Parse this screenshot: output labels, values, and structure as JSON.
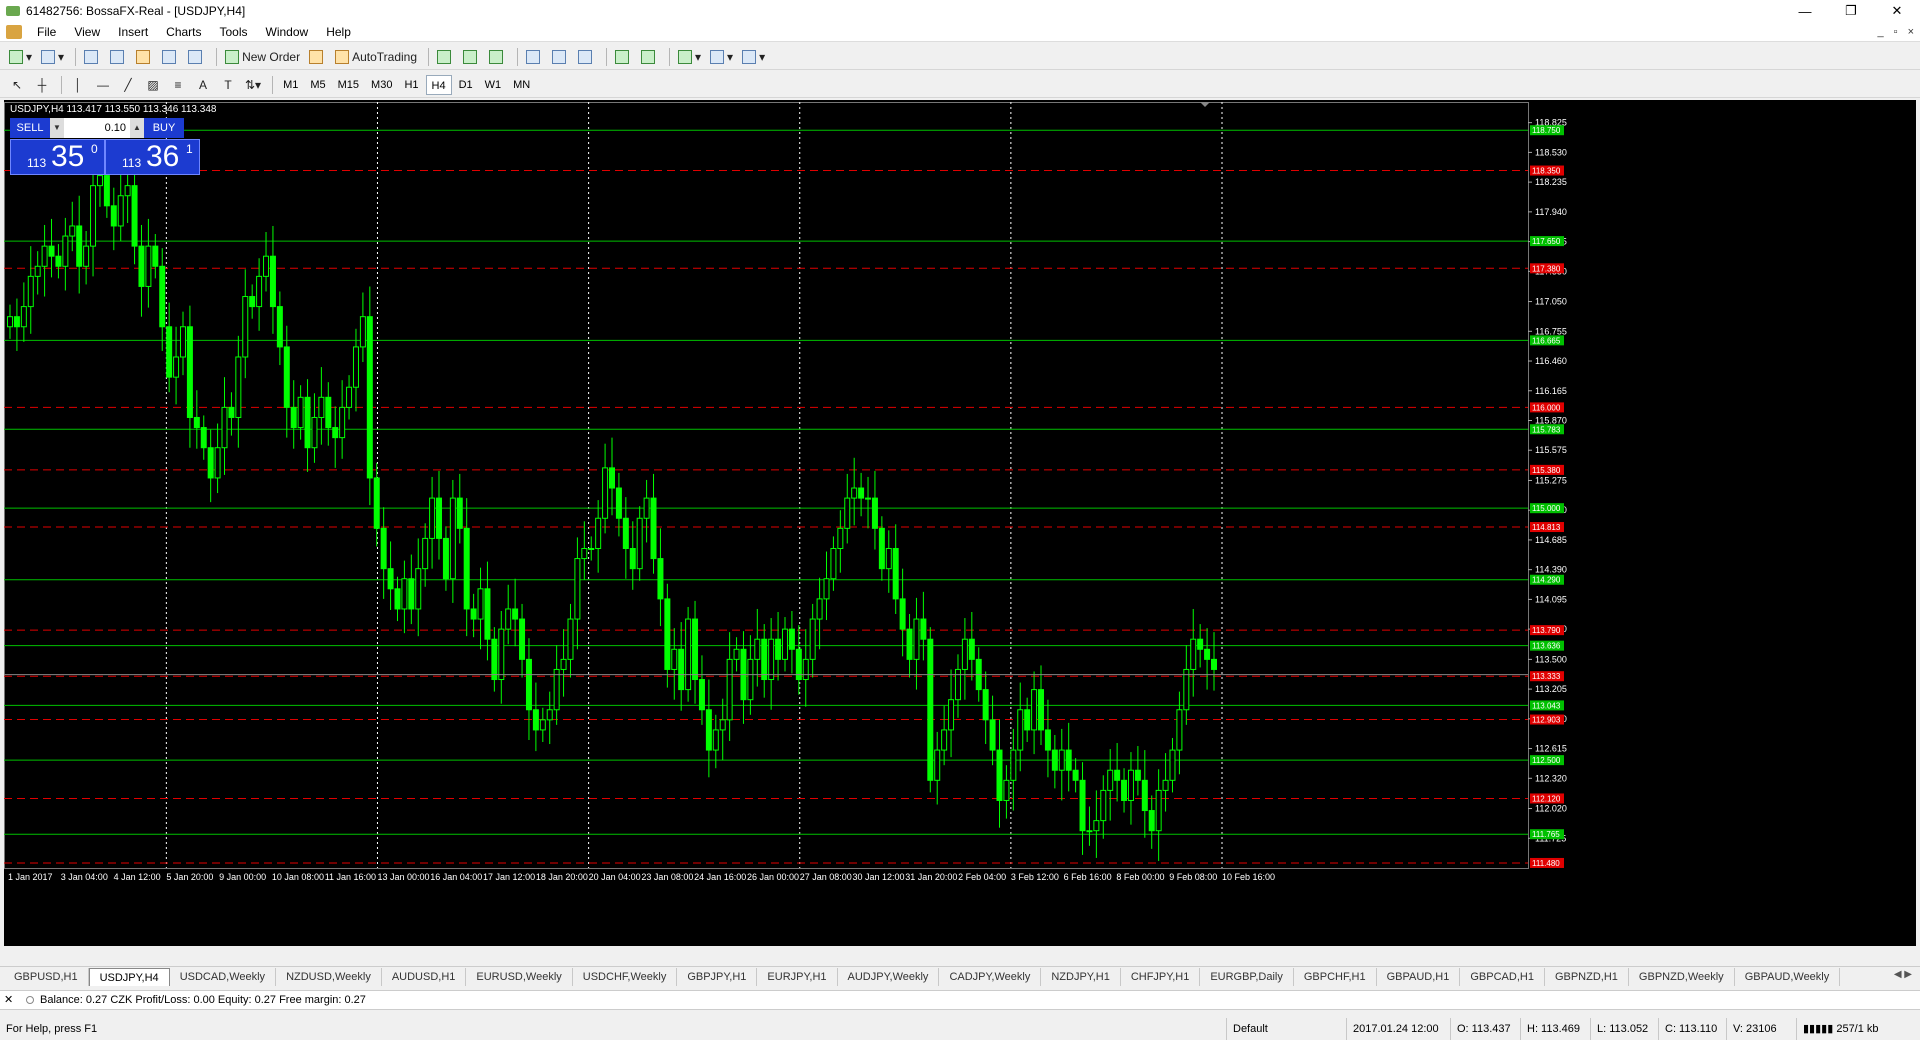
{
  "window": {
    "title": "61482756: BossaFX-Real - [USDJPY,H4]",
    "controls": [
      "—",
      "❐",
      "✕"
    ]
  },
  "menu": [
    "File",
    "View",
    "Insert",
    "Charts",
    "Tools",
    "Window",
    "Help"
  ],
  "toolbar": {
    "new_order": "New Order",
    "autotrading": "AutoTrading"
  },
  "timeframes": [
    "M1",
    "M5",
    "M15",
    "M30",
    "H1",
    "H4",
    "D1",
    "W1",
    "MN"
  ],
  "active_timeframe": "H4",
  "chart_header": {
    "label": "USDJPY,H4  113.417 113.550 113.346 113.348"
  },
  "one_click": {
    "sell_label": "SELL",
    "buy_label": "BUY",
    "lot": "0.10",
    "sell_small": "113",
    "sell_big": "35",
    "sell_sup": "0",
    "buy_small": "113",
    "buy_big": "36",
    "buy_sup": "1"
  },
  "chart_data": {
    "type": "candlestick",
    "symbol": "USDJPY",
    "timeframe": "H4",
    "ylim": [
      111.43,
      119.03
    ],
    "y_ticks": [
      "118.825",
      "118.530",
      "118.235",
      "117.940",
      "117.645",
      "117.350",
      "117.050",
      "116.755",
      "116.460",
      "116.165",
      "115.870",
      "115.575",
      "115.275",
      "114.980",
      "114.685",
      "114.390",
      "114.095",
      "113.800",
      "113.500",
      "113.205",
      "112.910",
      "112.615",
      "112.320",
      "112.020",
      "111.725"
    ],
    "x_ticks": [
      "1 Jan 2017",
      "3 Jan 04:00",
      "4 Jan 12:00",
      "5 Jan 20:00",
      "9 Jan 00:00",
      "10 Jan 08:00",
      "11 Jan 16:00",
      "13 Jan 00:00",
      "16 Jan 04:00",
      "17 Jan 12:00",
      "18 Jan 20:00",
      "20 Jan 04:00",
      "23 Jan 08:00",
      "24 Jan 16:00",
      "26 Jan 00:00",
      "27 Jan 08:00",
      "30 Jan 12:00",
      "31 Jan 20:00",
      "2 Feb 04:00",
      "3 Feb 12:00",
      "6 Feb 16:00",
      "8 Feb 00:00",
      "9 Feb 08:00",
      "10 Feb 16:00"
    ],
    "green_levels": [
      "118.750",
      "117.650",
      "116.665",
      "115.783",
      "115.000",
      "114.290",
      "113.636",
      "113.043",
      "112.500",
      "111.765"
    ],
    "red_levels": [
      "118.350",
      "117.380",
      "116.000",
      "115.380",
      "114.813",
      "113.790",
      "113.333",
      "112.903",
      "112.120",
      "111.480"
    ],
    "current_price": "113.348",
    "closes": [
      116.9,
      116.8,
      117.0,
      117.3,
      117.4,
      117.6,
      117.5,
      117.4,
      117.7,
      117.8,
      117.4,
      117.6,
      118.2,
      118.3,
      118.0,
      117.8,
      118.1,
      118.2,
      117.6,
      117.2,
      117.6,
      117.4,
      116.8,
      116.3,
      116.5,
      116.8,
      115.9,
      115.8,
      115.6,
      115.3,
      115.6,
      116.0,
      115.9,
      116.5,
      117.1,
      117.0,
      117.3,
      117.5,
      117.0,
      116.6,
      116.0,
      115.8,
      116.1,
      115.6,
      115.9,
      116.1,
      115.8,
      115.7,
      116.0,
      116.2,
      116.6,
      116.9,
      115.3,
      114.8,
      114.4,
      114.2,
      114.0,
      114.3,
      114.0,
      114.4,
      114.7,
      115.1,
      114.7,
      114.3,
      115.1,
      114.8,
      114.0,
      113.9,
      114.2,
      113.7,
      113.3,
      113.8,
      114.0,
      113.9,
      113.5,
      113.0,
      112.8,
      112.9,
      113.0,
      113.4,
      113.5,
      113.9,
      114.5,
      114.6,
      114.6,
      114.9,
      115.4,
      115.2,
      114.9,
      114.6,
      114.4,
      114.9,
      115.1,
      114.5,
      114.1,
      113.4,
      113.6,
      113.2,
      113.9,
      113.3,
      113.0,
      112.6,
      112.8,
      112.9,
      113.5,
      113.6,
      113.1,
      113.5,
      113.7,
      113.3,
      113.7,
      113.5,
      113.8,
      113.6,
      113.3,
      113.5,
      113.9,
      114.1,
      114.3,
      114.6,
      114.8,
      115.1,
      115.2,
      115.1,
      115.1,
      114.8,
      114.4,
      114.6,
      114.1,
      113.8,
      113.5,
      113.9,
      113.7,
      112.3,
      112.6,
      112.8,
      113.1,
      113.4,
      113.7,
      113.5,
      113.2,
      112.9,
      112.6,
      112.1,
      112.3,
      112.6,
      113.0,
      112.8,
      113.2,
      112.8,
      112.6,
      112.4,
      112.6,
      112.4,
      112.3,
      111.8,
      111.8,
      111.9,
      112.2,
      112.4,
      112.3,
      112.1,
      112.4,
      112.3,
      112.0,
      111.8,
      112.2,
      112.3,
      112.6,
      113.0,
      113.4,
      113.7,
      113.6,
      113.5,
      113.4
    ]
  },
  "tabs": [
    "GBPUSD,H1",
    "USDJPY,H4",
    "USDCAD,Weekly",
    "NZDUSD,Weekly",
    "AUDUSD,H1",
    "EURUSD,Weekly",
    "USDCHF,Weekly",
    "GBPJPY,H1",
    "EURJPY,H1",
    "AUDJPY,Weekly",
    "CADJPY,Weekly",
    "NZDJPY,H1",
    "CHFJPY,H1",
    "EURGBP,Daily",
    "GBPCHF,H1",
    "GBPAUD,H1",
    "GBPCAD,H1",
    "GBPNZD,H1",
    "GBPNZD,Weekly",
    "GBPAUD,Weekly"
  ],
  "active_tab": "USDJPY,H4",
  "terminal": {
    "text": "Balance: 0.27 CZK  Profit/Loss: 0.00  Equity: 0.27  Free margin: 0.27"
  },
  "status": {
    "help": "For Help, press F1",
    "profile": "Default",
    "datetime": "2017.01.24 12:00",
    "open": "O: 113.437",
    "high": "H: 113.469",
    "low": "L: 113.052",
    "close": "C: 113.110",
    "volume": "V: 23106",
    "traffic": "257/1 kb"
  },
  "colors": {
    "chart_bg": "#000000",
    "candle": "#00ff00",
    "grid": "#ffffff",
    "green_line": "#00c000",
    "red_line": "#e00000",
    "price_label_green": "#00b000",
    "price_label_red": "#e00000",
    "one_click": "#1c3bd0"
  }
}
